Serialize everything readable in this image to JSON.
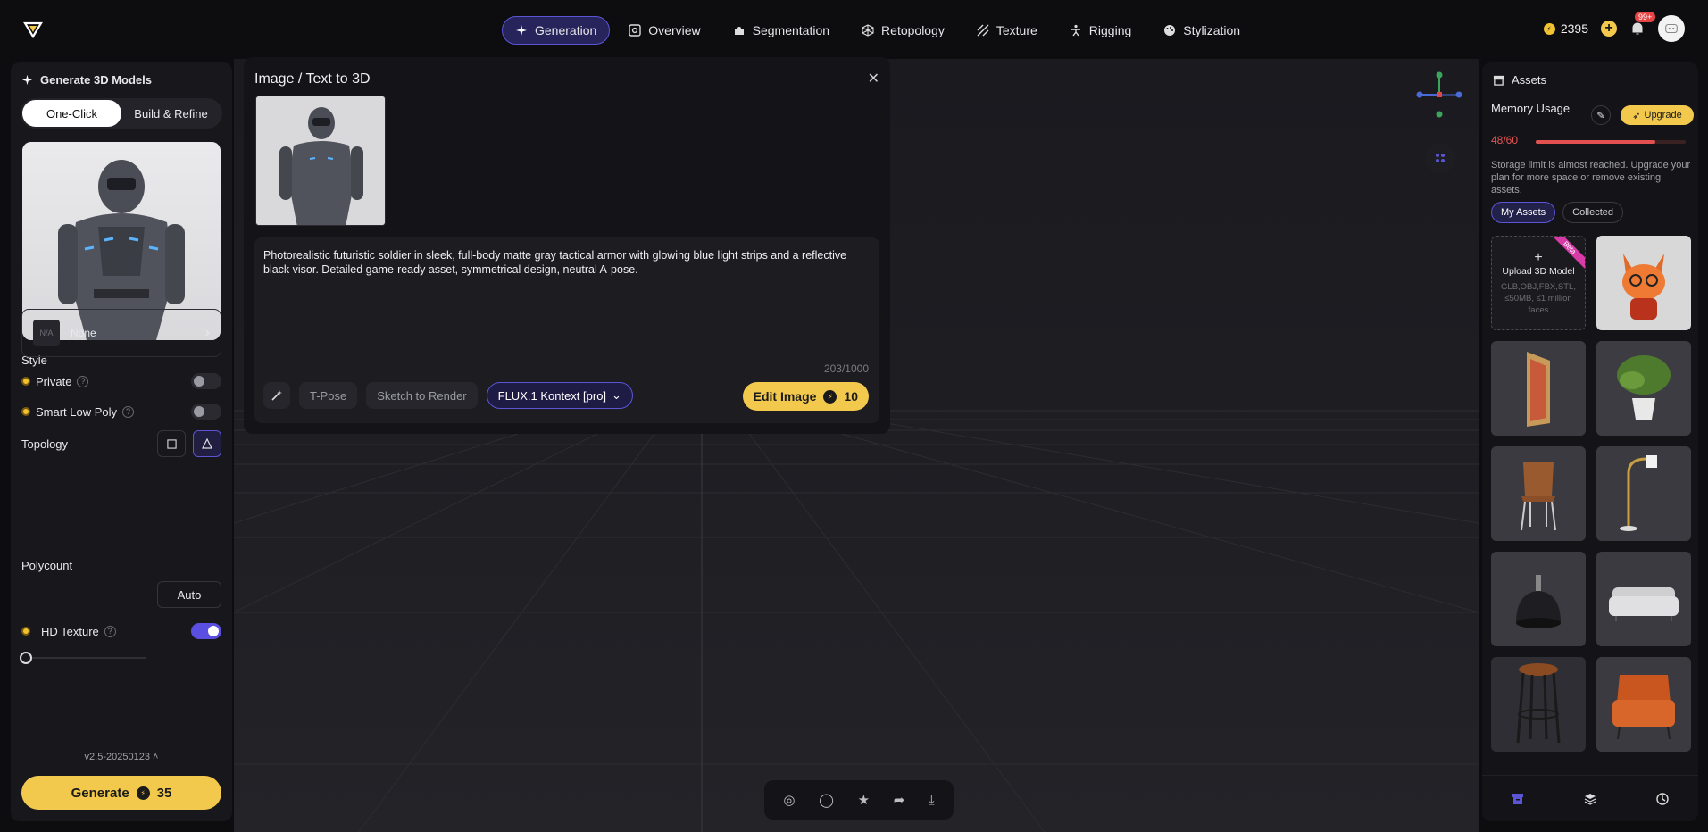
{
  "nav": {
    "items": [
      {
        "label": "Generation",
        "icon": "sparkle-icon",
        "active": true
      },
      {
        "label": "Overview",
        "icon": "scan-icon"
      },
      {
        "label": "Segmentation",
        "icon": "puzzle-icon"
      },
      {
        "label": "Retopology",
        "icon": "cube-mesh-icon"
      },
      {
        "label": "Texture",
        "icon": "stripes-icon"
      },
      {
        "label": "Rigging",
        "icon": "figure-icon"
      },
      {
        "label": "Stylization",
        "icon": "palette-icon"
      }
    ]
  },
  "header": {
    "credits": "2395",
    "notifications": "99+"
  },
  "left": {
    "title": "Generate 3D Models",
    "mode_tabs": [
      "One-Click",
      "Build & Refine"
    ],
    "style_label": "Style",
    "style_badge": "N/A",
    "style_value": "None",
    "private_label": "Private",
    "smart_low_poly_label": "Smart Low Poly",
    "topology_label": "Topology",
    "polycount_label": "Polycount",
    "polycount_value": "Auto",
    "hd_texture_label": "HD Texture",
    "version": "v2.5-20250123",
    "generate_label": "Generate",
    "generate_cost": "35"
  },
  "dialog": {
    "title": "Image / Text to 3D",
    "prompt": "Photorealistic futuristic soldier in sleek, full-body matte gray tactical armor with glowing blue light strips and a reflective black visor. Detailed game-ready asset, symmetrical design, neutral A-pose.",
    "counter": "203/1000",
    "tpose": "T-Pose",
    "sketch": "Sketch to Render",
    "model": "FLUX.1 Kontext [pro]",
    "edit_label": "Edit Image",
    "edit_cost": "10"
  },
  "right": {
    "title": "Assets",
    "memory_label": "Memory Usage",
    "upgrade_label": "Upgrade",
    "usage": "48/60",
    "usage_fraction": 0.8,
    "warning": "Storage limit is almost reached. Upgrade your plan for more space or remove existing assets.",
    "tabs": [
      "My Assets",
      "Collected"
    ],
    "upload_title": "Upload 3D Model",
    "upload_sub": "GLB,OBJ,FBX,STL, ≤50MB, ≤1 million faces",
    "upload_badge": "Beta",
    "assets": [
      "fox-character",
      "framed-painting",
      "potted-plant",
      "wooden-chair",
      "floor-lamp",
      "pendant-lamp",
      "sofa",
      "bar-stool",
      "leather-armchair"
    ]
  },
  "colors": {
    "accent": "#5b55d6",
    "brand_yellow": "#f2c94c",
    "warning_red": "#e25050"
  }
}
